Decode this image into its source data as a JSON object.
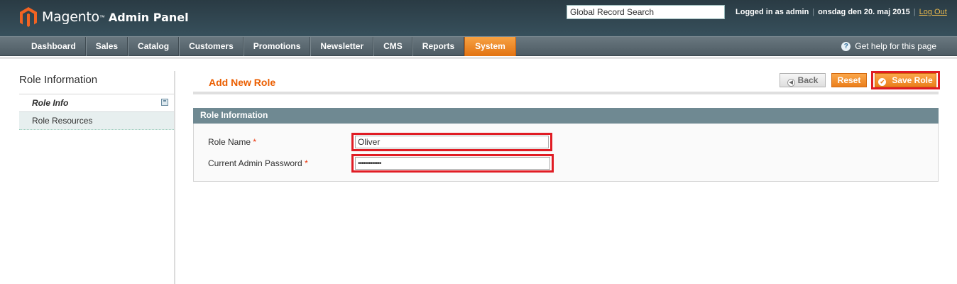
{
  "header": {
    "brand": "Magento",
    "tm": "™",
    "subtitle": "Admin Panel",
    "search_value": "Global Record Search",
    "logged_in": "Logged in as admin",
    "date": "onsdag den 20. maj 2015",
    "logout": "Log Out"
  },
  "nav": {
    "items": [
      "Dashboard",
      "Sales",
      "Catalog",
      "Customers",
      "Promotions",
      "Newsletter",
      "CMS",
      "Reports",
      "System"
    ],
    "active": "System",
    "help": "Get help for this page"
  },
  "sidebar": {
    "title": "Role Information",
    "tabs": [
      {
        "label": "Role Info",
        "active": true
      },
      {
        "label": "Role Resources",
        "active": false
      }
    ]
  },
  "main": {
    "title": "Add New Role",
    "buttons": {
      "back": "Back",
      "reset": "Reset",
      "save": "Save Role"
    },
    "fieldset_title": "Role Information",
    "fields": {
      "role_name_label": "Role Name",
      "role_name_value": "Oliver",
      "password_label": "Current Admin Password",
      "password_value": "•••••••••••••",
      "required_mark": "*"
    }
  },
  "colors": {
    "accent": "#eb5e00",
    "highlight_outline": "#e01c24",
    "header_bg": "#2a3b44",
    "fieldset_head": "#6f8992"
  }
}
